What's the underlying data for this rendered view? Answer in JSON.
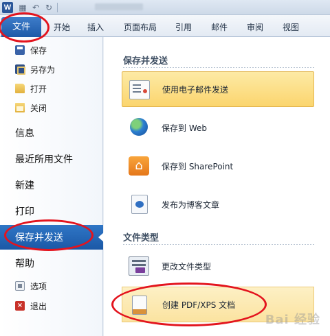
{
  "app": {
    "icon_letter": "W"
  },
  "ribbon": {
    "file_tab": "文件",
    "tabs": [
      "开始",
      "插入",
      "页面布局",
      "引用",
      "邮件",
      "审阅",
      "视图"
    ]
  },
  "backstage_nav": {
    "small_items_top": [
      {
        "label": "保存",
        "icon": "save-icon"
      },
      {
        "label": "另存为",
        "icon": "save-as-icon"
      },
      {
        "label": "打开",
        "icon": "open-folder-icon"
      },
      {
        "label": "关闭",
        "icon": "close-folder-icon"
      }
    ],
    "big_items": [
      "信息",
      "最近所用文件",
      "新建",
      "打印",
      "保存并发送",
      "帮助"
    ],
    "active_item": "保存并发送",
    "small_items_bottom": [
      {
        "label": "选项",
        "icon": "options-icon"
      },
      {
        "label": "退出",
        "icon": "exit-icon"
      }
    ]
  },
  "save_send": {
    "section1_title": "保存并发送",
    "section1_items": [
      {
        "label": "使用电子邮件发送",
        "icon": "email-icon",
        "selected": true
      },
      {
        "label": "保存到 Web",
        "icon": "globe-icon"
      },
      {
        "label": "保存到 SharePoint",
        "icon": "sharepoint-icon"
      },
      {
        "label": "发布为博客文章",
        "icon": "blog-icon"
      }
    ],
    "section2_title": "文件类型",
    "section2_items": [
      {
        "label": "更改文件类型",
        "icon": "change-file-type-icon"
      },
      {
        "label": "创建 PDF/XPS 文档",
        "icon": "pdf-xps-icon",
        "highlighted": true
      }
    ]
  },
  "watermark": "Bai 经验",
  "colors": {
    "active_nav": "#1b58a6",
    "selected_option": "#fbd56e",
    "annotation_ring": "#e3141e"
  }
}
